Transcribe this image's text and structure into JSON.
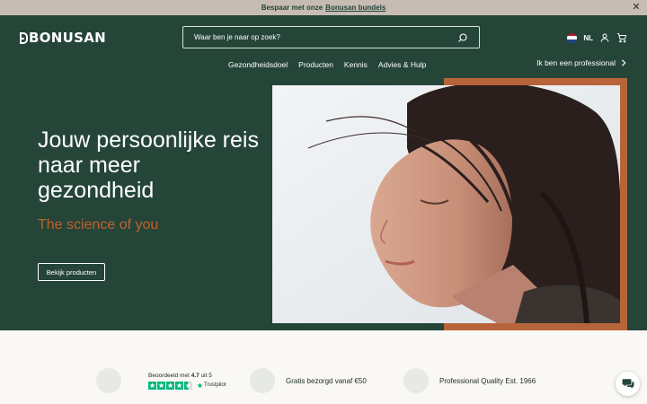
{
  "promo": {
    "text": "Bespaar met onze",
    "link": "Bonusan bundels"
  },
  "header": {
    "logo": "BONUSAN",
    "search_placeholder": "Waar ben je naar op zoek?",
    "language": "NL"
  },
  "nav": {
    "items": [
      "Gezondheidsdoel",
      "Producten",
      "Kennis",
      "Advies & Hulp"
    ],
    "professional": "Ik ben een professional"
  },
  "hero": {
    "title": "Jouw persoonlijke reis naar meer gezondheid",
    "subtitle": "The science of you",
    "button": "Bekijk producten"
  },
  "usps": {
    "rating_prefix": "Beoordeeld met",
    "rating_value": "4.7",
    "rating_suffix": "uit 5",
    "trustpilot": "Trustpilot",
    "shipping": "Gratis bezorgd vanaf €50",
    "quality": "Professional Quality Est. 1966",
    "rating_stars": 4.5
  },
  "colors": {
    "brand_green": "#254538",
    "accent_orange": "#c0622b",
    "trustpilot_green": "#00b67a"
  },
  "icons": [
    "close-icon",
    "search-icon",
    "flag-nl-icon",
    "user-icon",
    "cart-icon",
    "chevron-right-icon",
    "star-icon",
    "chat-icon"
  ]
}
